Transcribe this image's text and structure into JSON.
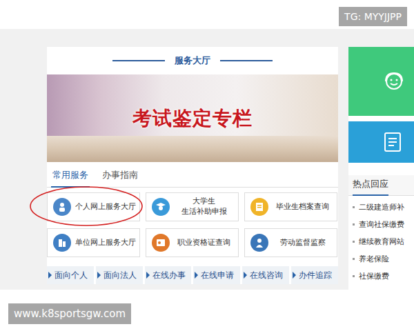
{
  "watermarks": {
    "top": "TG: MYYJJPP",
    "bottom": "www.k8sportsgw.com"
  },
  "panel": {
    "title": "服务大厅",
    "banner": "考试鉴定专栏"
  },
  "tabs": [
    {
      "label": "常用服务",
      "selected": true
    },
    {
      "label": "办事指南",
      "selected": false
    }
  ],
  "services": [
    {
      "lines": [
        "个人网上服务大厅"
      ],
      "kind": "person",
      "color": "#4a86c8",
      "highlighted": true
    },
    {
      "lines": [
        "大学生",
        "生活补助申报"
      ],
      "kind": "graduate",
      "color": "#3a9ad9",
      "highlighted": false
    },
    {
      "lines": [
        "毕业生档案查询"
      ],
      "kind": "document",
      "color": "#f0b429",
      "highlighted": false
    },
    {
      "lines": [
        "单位网上服务大厅"
      ],
      "kind": "building",
      "color": "#3f7fc4",
      "highlighted": false
    },
    {
      "lines": [
        "职业资格证查询"
      ],
      "kind": "card",
      "color": "#e0782a",
      "highlighted": false
    },
    {
      "lines": [
        "劳动监督监察"
      ],
      "kind": "worker",
      "color": "#3a76b8",
      "highlighted": false
    }
  ],
  "links": [
    "面向个人",
    "面向法人",
    "在线办事",
    "在线申请",
    "在线咨询",
    "办件追踪"
  ],
  "side_cards": [
    {
      "kind": "support",
      "color": "#3fc97c"
    },
    {
      "kind": "form",
      "color": "#2aa0d8"
    }
  ],
  "hotspot": {
    "title": "热点回应",
    "items": [
      "二级建造师补",
      "查询社保缴费",
      "继续教育网站",
      "养老保险",
      "社保缴费"
    ]
  }
}
